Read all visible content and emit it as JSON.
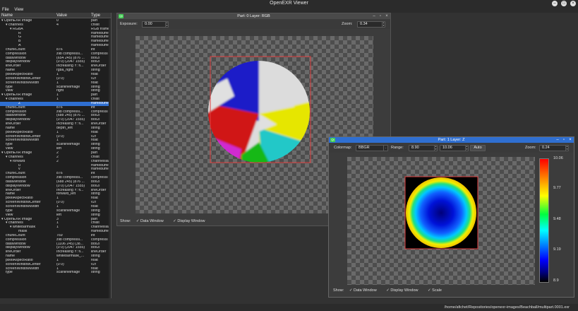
{
  "app": {
    "title": "OpenEXR Viewer",
    "menu": [
      "File",
      "View"
    ]
  },
  "tree": {
    "headers": [
      "Name",
      "Value",
      "Type"
    ],
    "rows": [
      {
        "name": "▾ OpenEXR Image",
        "value": "0",
        "type": "part",
        "indent": 0
      },
      {
        "name": "▾ channels",
        "value": "4",
        "type": "chlist",
        "indent": 1
      },
      {
        "name": "▾ RGBA",
        "value": "",
        "type": "RGB frame",
        "indent": 2
      },
      {
        "name": "R",
        "value": "",
        "type": "framebuffe",
        "indent": 4
      },
      {
        "name": "G",
        "value": "",
        "type": "framebuffe",
        "indent": 4
      },
      {
        "name": "B",
        "value": "",
        "type": "framebuffe",
        "indent": 4
      },
      {
        "name": "A",
        "value": "",
        "type": "framebuffe",
        "indent": 4
      },
      {
        "name": "chunkCount",
        "value": "876",
        "type": "int",
        "indent": 1
      },
      {
        "name": "compression",
        "value": "zlib compressi...",
        "type": "compressi",
        "indent": 1
      },
      {
        "name": "dataWindow",
        "value": "(654 245) (876 ...",
        "type": "box2i",
        "indent": 1
      },
      {
        "name": "displayWindow",
        "value": "(0 0) (2047 1555)",
        "type": "box2i",
        "indent": 1
      },
      {
        "name": "lineOrder",
        "value": "Increasing Y: fi...",
        "type": "lineOrder",
        "indent": 1
      },
      {
        "name": "name",
        "value": "rgba_right",
        "type": "string",
        "indent": 1
      },
      {
        "name": "pixelAspectRatio",
        "value": "1",
        "type": "float",
        "indent": 1
      },
      {
        "name": "screenWindowCenter",
        "value": "(0 0)",
        "type": "v2f",
        "indent": 1
      },
      {
        "name": "screenWindowWidth",
        "value": "1",
        "type": "float",
        "indent": 1
      },
      {
        "name": "type",
        "value": "scanlineimage",
        "type": "string",
        "indent": 1
      },
      {
        "name": "view",
        "value": "right",
        "type": "string",
        "indent": 1
      },
      {
        "name": "▾ OpenEXR Image",
        "value": "1",
        "type": "part",
        "indent": 0
      },
      {
        "name": "▾ channels",
        "value": "1",
        "type": "chlist",
        "indent": 1
      },
      {
        "name": "Z",
        "value": "",
        "type": "framebuffe",
        "indent": 4,
        "selected": true
      },
      {
        "name": "chunkCount",
        "value": "876",
        "type": "int",
        "indent": 1
      },
      {
        "name": "compression",
        "value": "zlib compressi...",
        "type": "compressi",
        "indent": 1
      },
      {
        "name": "dataWindow",
        "value": "(688 245) (876 ...",
        "type": "box2i",
        "indent": 1
      },
      {
        "name": "displayWindow",
        "value": "(0 0) (2047 1555)",
        "type": "box2i",
        "indent": 1
      },
      {
        "name": "lineOrder",
        "value": "Increasing Y: fi...",
        "type": "lineOrder",
        "indent": 1
      },
      {
        "name": "name",
        "value": "depth_left",
        "type": "string",
        "indent": 1
      },
      {
        "name": "pixelAspectRatio",
        "value": "1",
        "type": "float",
        "indent": 1
      },
      {
        "name": "screenWindowCenter",
        "value": "(0 0)",
        "type": "v2f",
        "indent": 1
      },
      {
        "name": "screenWindowWidth",
        "value": "1",
        "type": "float",
        "indent": 1
      },
      {
        "name": "type",
        "value": "scanlineimage",
        "type": "string",
        "indent": 1
      },
      {
        "name": "view",
        "value": "left",
        "type": "string",
        "indent": 1
      },
      {
        "name": "▾ OpenEXR Image",
        "value": "2",
        "type": "part",
        "indent": 0
      },
      {
        "name": "▾ channels",
        "value": "2",
        "type": "chlist",
        "indent": 1
      },
      {
        "name": "▾ forward",
        "value": "2",
        "type": "channelsla",
        "indent": 2
      },
      {
        "name": "u",
        "value": "",
        "type": "framebuffe",
        "indent": 4
      },
      {
        "name": "v",
        "value": "",
        "type": "framebuffe",
        "indent": 4
      },
      {
        "name": "chunkCount",
        "value": "876",
        "type": "int",
        "indent": 1
      },
      {
        "name": "compression",
        "value": "zlib compressi...",
        "type": "compressi",
        "indent": 1
      },
      {
        "name": "dataWindow",
        "value": "(688 245) (876 ...",
        "type": "box2i",
        "indent": 1
      },
      {
        "name": "displayWindow",
        "value": "(0 0) (2047 1555)",
        "type": "box2i",
        "indent": 1
      },
      {
        "name": "lineOrder",
        "value": "Increasing Y: fi...",
        "type": "lineOrder",
        "indent": 1
      },
      {
        "name": "name",
        "value": "forward_left",
        "type": "string",
        "indent": 1
      },
      {
        "name": "pixelAspectRatio",
        "value": "1",
        "type": "float",
        "indent": 1
      },
      {
        "name": "screenWindowCenter",
        "value": "(0 0)",
        "type": "v2f",
        "indent": 1
      },
      {
        "name": "screenWindowWidth",
        "value": "1",
        "type": "float",
        "indent": 1
      },
      {
        "name": "type",
        "value": "scanlineimage",
        "type": "string",
        "indent": 1
      },
      {
        "name": "view",
        "value": "left",
        "type": "string",
        "indent": 1
      },
      {
        "name": "▾ OpenEXR Image",
        "value": "3",
        "type": "part",
        "indent": 0
      },
      {
        "name": "▾ channels",
        "value": "1",
        "type": "chlist",
        "indent": 1
      },
      {
        "name": "▾ whitebarmask",
        "value": "1",
        "type": "channelsla",
        "indent": 2
      },
      {
        "name": "mask",
        "value": "",
        "type": "framebuffe",
        "indent": 4
      },
      {
        "name": "chunkCount",
        "value": "769",
        "type": "int",
        "indent": 1
      },
      {
        "name": "compression",
        "value": "zlib compressi...",
        "type": "compressi",
        "indent": 1
      },
      {
        "name": "dataWindow",
        "value": "(1106 245) (38...",
        "type": "box2i",
        "indent": 1
      },
      {
        "name": "displayWindow",
        "value": "(0 0) (2047 1555)",
        "type": "box2i",
        "indent": 1
      },
      {
        "name": "lineOrder",
        "value": "Increasing Y: fi...",
        "type": "lineOrder",
        "indent": 1
      },
      {
        "name": "name",
        "value": "whitebarmask_...",
        "type": "string",
        "indent": 1
      },
      {
        "name": "pixelAspectRatio",
        "value": "1",
        "type": "float",
        "indent": 1
      },
      {
        "name": "screenWindowCenter",
        "value": "(0 0)",
        "type": "v2f",
        "indent": 1
      },
      {
        "name": "screenWindowWidth",
        "value": "1",
        "type": "float",
        "indent": 1
      },
      {
        "name": "type",
        "value": "scanlineimage",
        "type": "string",
        "indent": 1
      }
    ]
  },
  "main_window": {
    "title": "Part: 0 Layer: RGB",
    "exposure_label": "Exposure:",
    "exposure_value": "0.00",
    "zoom_label": "Zoom:",
    "zoom_value": "0.34",
    "show_label": "Show:",
    "show_options": [
      "Data Window",
      "Display Window"
    ]
  },
  "z_window": {
    "title": "Part: 1 Layer: Z",
    "colormap_label": "Colormap:",
    "colormap_value": "BBGR",
    "range_label": "Range:",
    "range_min": "8.90",
    "range_max": "10.06",
    "auto_label": "Auto",
    "zoom_label": "Zoom:",
    "zoom_value": "0.24",
    "scale_ticks": [
      "10.06",
      "9.77",
      "9.48",
      "9.19",
      "8.9"
    ],
    "show_label": "Show:",
    "show_options": [
      "Data Window",
      "Display Window",
      "Scale"
    ]
  },
  "status": {
    "path": "/home/afichet/Repositories/openexr-images/Beachball/multipart.0001.exr"
  },
  "colors": {
    "selection": "#2f6fd1",
    "qt_green": "#41cd52",
    "data_window_border": "#e04040"
  }
}
